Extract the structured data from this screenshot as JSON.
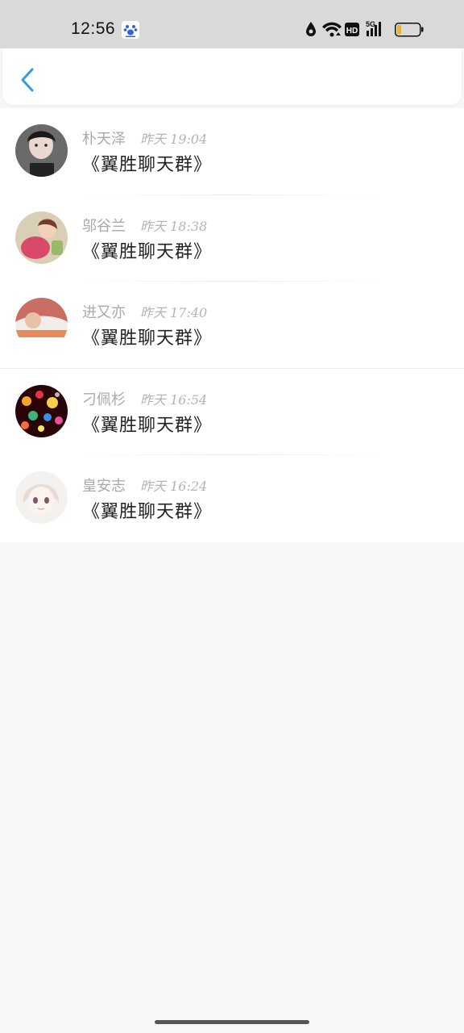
{
  "status_bar": {
    "time": "12:56",
    "network_label": "5G",
    "hd_label": "HD",
    "battery_color": "#f2b705"
  },
  "header": {
    "back_icon": "chevron-left-icon",
    "accent_color": "#2d9fe0"
  },
  "items": [
    {
      "name": "朴天泽",
      "time": "昨天 19:04",
      "message": "《翼胜聊天群》",
      "avatar": "portrait-photo"
    },
    {
      "name": "邬谷兰",
      "time": "昨天 18:38",
      "message": "《翼胜聊天群》",
      "avatar": "illustration-pink"
    },
    {
      "name": "进又亦",
      "time": "昨天 17:40",
      "message": "《翼胜聊天群》",
      "avatar": "photo-orange"
    },
    {
      "name": "刁佩杉",
      "time": "昨天 16:54",
      "message": "《翼胜聊天群》",
      "avatar": "bokeh-lights"
    },
    {
      "name": "皇安志",
      "time": "昨天 16:24",
      "message": "《翼胜聊天群》",
      "avatar": "anime-girl"
    }
  ]
}
